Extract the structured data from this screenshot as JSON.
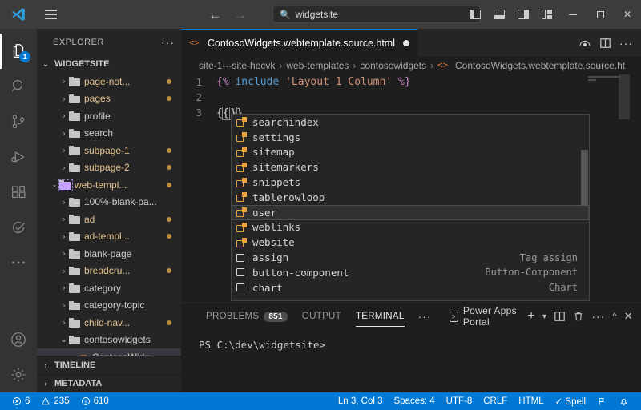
{
  "titlebar": {
    "logo_icon": "vscode-logo-icon",
    "menu_icon": "hamburger-menu-icon",
    "back_icon": "arrow-left-icon",
    "forward_icon": "arrow-right-icon",
    "search": {
      "icon": "search-icon",
      "value": "widgetsite",
      "placeholder": "Search"
    },
    "layout_icons": [
      "toggle-primary-sidebar-icon",
      "toggle-panel-icon",
      "toggle-secondary-sidebar-icon",
      "customize-layout-icon"
    ],
    "window_controls": [
      "minimize-button",
      "maximize-button",
      "close-button"
    ],
    "close_glyph": "✕"
  },
  "activitybar": {
    "items": [
      {
        "name": "explorer",
        "icon": "files-icon",
        "active": true,
        "badge": "1"
      },
      {
        "name": "search",
        "icon": "search-icon",
        "active": false,
        "badge": ""
      },
      {
        "name": "source-control",
        "icon": "source-control-icon",
        "active": false,
        "badge": ""
      },
      {
        "name": "run-and-debug",
        "icon": "run-debug-icon",
        "active": false,
        "badge": ""
      },
      {
        "name": "extensions",
        "icon": "extensions-icon",
        "active": false,
        "badge": ""
      },
      {
        "name": "testing",
        "icon": "testing-check-icon",
        "active": false,
        "badge": ""
      },
      {
        "name": "more-views",
        "icon": "ellipsis-icon",
        "active": false,
        "badge": ""
      }
    ],
    "bottom": [
      {
        "name": "accounts",
        "icon": "account-icon"
      },
      {
        "name": "manage-settings",
        "icon": "gear-icon"
      }
    ]
  },
  "sidebar": {
    "title": "EXPLORER",
    "more_actions_glyph": "···",
    "root_section": "WIDGETSITE",
    "chevron_open": "⌄",
    "chevron_closed": "›",
    "tree": [
      {
        "label": "page-not...",
        "indent": 2,
        "state": "closed",
        "modified": true,
        "kind": "folder"
      },
      {
        "label": "pages",
        "indent": 2,
        "state": "closed",
        "modified": true,
        "kind": "folder"
      },
      {
        "label": "profile",
        "indent": 2,
        "state": "closed",
        "modified": false,
        "kind": "folder"
      },
      {
        "label": "search",
        "indent": 2,
        "state": "closed",
        "modified": false,
        "kind": "folder"
      },
      {
        "label": "subpage-1",
        "indent": 2,
        "state": "closed",
        "modified": true,
        "kind": "folder"
      },
      {
        "label": "subpage-2",
        "indent": 2,
        "state": "closed",
        "modified": true,
        "kind": "folder"
      },
      {
        "label": "web-templ...",
        "indent": 1,
        "state": "open",
        "modified": true,
        "kind": "folder-special"
      },
      {
        "label": "100%-blank-pa...",
        "indent": 2,
        "state": "closed",
        "modified": false,
        "kind": "folder"
      },
      {
        "label": "ad",
        "indent": 2,
        "state": "closed",
        "modified": true,
        "kind": "folder"
      },
      {
        "label": "ad-templ...",
        "indent": 2,
        "state": "closed",
        "modified": true,
        "kind": "folder"
      },
      {
        "label": "blank-page",
        "indent": 2,
        "state": "closed",
        "modified": false,
        "kind": "folder"
      },
      {
        "label": "breadcru...",
        "indent": 2,
        "state": "closed",
        "modified": true,
        "kind": "folder"
      },
      {
        "label": "category",
        "indent": 2,
        "state": "closed",
        "modified": false,
        "kind": "folder"
      },
      {
        "label": "category-topic",
        "indent": 2,
        "state": "closed",
        "modified": false,
        "kind": "folder"
      },
      {
        "label": "child-nav...",
        "indent": 2,
        "state": "closed",
        "modified": true,
        "kind": "folder"
      },
      {
        "label": "contosowidgets",
        "indent": 2,
        "state": "open",
        "modified": false,
        "kind": "folder"
      },
      {
        "label": "ContosoWidg",
        "indent": 3,
        "state": "none",
        "modified": false,
        "kind": "file-html",
        "selected": true
      }
    ],
    "bottom_sections": [
      "TIMELINE",
      "METADATA"
    ]
  },
  "editor": {
    "tab": {
      "label": "ContosoWidgets.webtemplate.source.html",
      "icon": "html-file-icon",
      "dirty": true
    },
    "tab_actions": [
      "open-preview-icon",
      "split-editor-icon",
      "more-actions-icon"
    ],
    "breadcrumbs": [
      "site-1---site-hecvk",
      "web-templates",
      "contosowidgets",
      "ContosoWidgets.webtemplate.source.ht"
    ],
    "breadcrumb_separator": "›",
    "lines": [
      {
        "num": "1",
        "text": "{% include 'Layout 1 Column' %}"
      },
      {
        "num": "2",
        "text": ""
      },
      {
        "num": "3",
        "text": "{{}}"
      }
    ],
    "line1_parts": {
      "open": "{%",
      "keyword": " include ",
      "string": "'Layout 1 Column'",
      "close": " %}"
    }
  },
  "suggest": {
    "items": [
      {
        "label": "searchindex",
        "icon": "field-icon",
        "detail": "",
        "selected": false
      },
      {
        "label": "settings",
        "icon": "field-icon",
        "detail": "",
        "selected": false
      },
      {
        "label": "sitemap",
        "icon": "field-icon",
        "detail": "",
        "selected": false
      },
      {
        "label": "sitemarkers",
        "icon": "field-icon",
        "detail": "",
        "selected": false
      },
      {
        "label": "snippets",
        "icon": "field-icon",
        "detail": "",
        "selected": false
      },
      {
        "label": "tablerowloop",
        "icon": "field-icon",
        "detail": "",
        "selected": false
      },
      {
        "label": "user",
        "icon": "field-icon",
        "detail": "",
        "selected": true
      },
      {
        "label": "weblinks",
        "icon": "field-icon",
        "detail": "",
        "selected": false
      },
      {
        "label": "website",
        "icon": "field-icon",
        "detail": "",
        "selected": false
      },
      {
        "label": "assign",
        "icon": "snippet-icon",
        "detail": "Tag assign",
        "selected": false
      },
      {
        "label": "button-component",
        "icon": "snippet-icon",
        "detail": "Button-Component",
        "selected": false
      },
      {
        "label": "chart",
        "icon": "snippet-icon",
        "detail": "Chart",
        "selected": false
      }
    ]
  },
  "panel": {
    "tabs": [
      {
        "label": "PROBLEMS",
        "badge": "851",
        "active": false
      },
      {
        "label": "OUTPUT",
        "badge": "",
        "active": false
      },
      {
        "label": "TERMINAL",
        "badge": "",
        "active": true
      }
    ],
    "overflow_glyph": "···",
    "terminal_selector": {
      "label": "Power Apps Portal",
      "icon": "terminal-icon"
    },
    "actions": [
      "new-terminal-icon",
      "terminal-dropdown-icon",
      "split-terminal-icon",
      "kill-terminal-icon",
      "panel-more-icon",
      "maximize-panel-icon",
      "close-panel-icon"
    ],
    "content": "PS C:\\dev\\widgetsite>"
  },
  "statusbar": {
    "left": [
      {
        "name": "errors",
        "icon": "error-icon",
        "value": "6"
      },
      {
        "name": "warnings",
        "icon": "warning-icon",
        "value": "235"
      },
      {
        "name": "infos",
        "icon": "info-icon",
        "value": "610"
      }
    ],
    "right": [
      {
        "name": "cursor-position",
        "label": "Ln 3, Col 3"
      },
      {
        "name": "indentation",
        "label": "Spaces: 4"
      },
      {
        "name": "encoding",
        "label": "UTF-8"
      },
      {
        "name": "eol",
        "label": "CRLF"
      },
      {
        "name": "language-mode",
        "label": "HTML"
      },
      {
        "name": "spell-checker",
        "label": "✓ Spell"
      }
    ],
    "icons": [
      "remote-window-icon",
      "notifications-bell-icon"
    ],
    "background": "#0078d4"
  }
}
